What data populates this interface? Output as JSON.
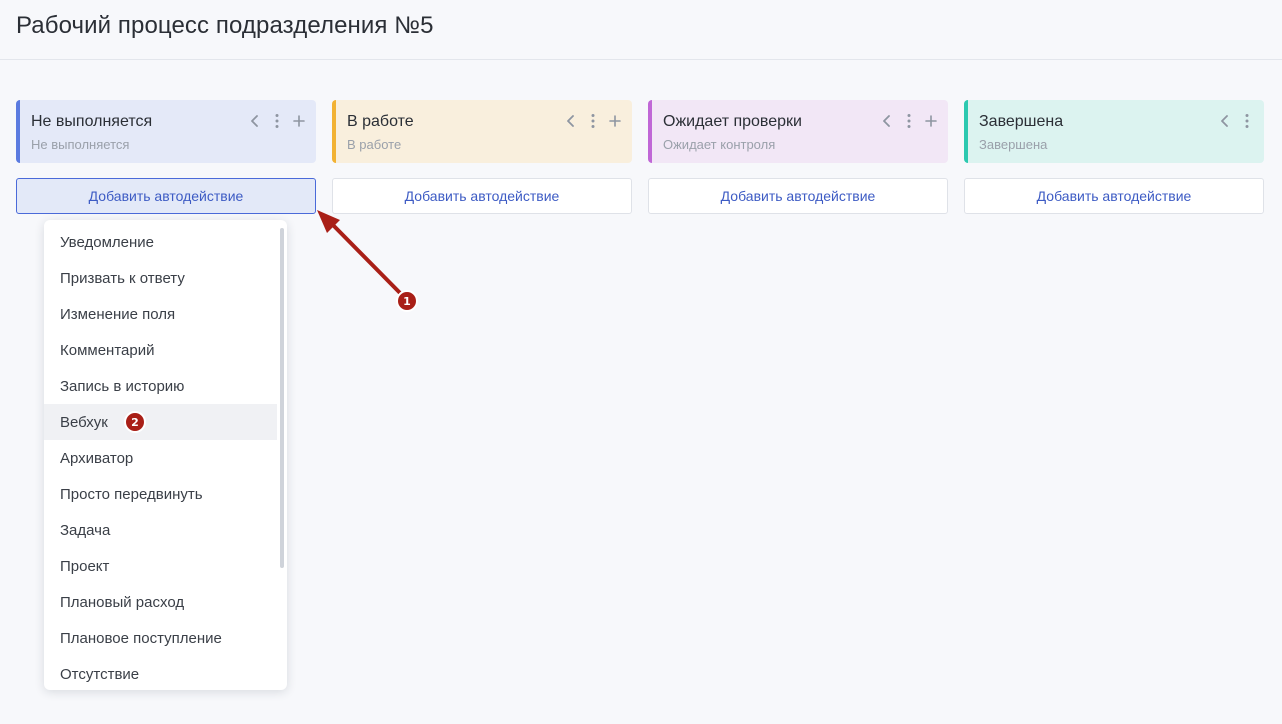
{
  "page": {
    "title": "Рабочий процесс подразделения №5"
  },
  "columns": [
    {
      "name": "Не выполняется",
      "description": "Не выполняется",
      "accent": "#5b7be0",
      "bg": "#e4e9f8",
      "add_label": "Добавить автодействие"
    },
    {
      "name": "В работе",
      "description": "В работе",
      "accent": "#f2b233",
      "bg": "#f9efdd",
      "add_label": "Добавить автодействие"
    },
    {
      "name": "Ожидает проверки",
      "description": "Ожидает контроля",
      "accent": "#c067d6",
      "bg": "#f2e7f6",
      "add_label": "Добавить автодействие"
    },
    {
      "name": "Завершена",
      "description": "Завершена",
      "accent": "#2cc9b0",
      "bg": "#dcf3f0",
      "add_label": "Добавить автодействие"
    }
  ],
  "icons": {
    "collapse": "chevron-left-icon",
    "more": "more-vertical-icon",
    "add": "plus-icon"
  },
  "dropdown": {
    "items": [
      "Уведомление",
      "Призвать к ответу",
      "Изменение поля",
      "Комментарий",
      "Запись в историю",
      "Вебхук",
      "Архиватор",
      "Просто передвинуть",
      "Задача",
      "Проект",
      "Плановый расход",
      "Плановое поступление",
      "Отсутствие"
    ],
    "hovered": "Вебхук"
  },
  "annotations": {
    "badge1": "1",
    "badge2": "2",
    "color": "#a91f17"
  }
}
